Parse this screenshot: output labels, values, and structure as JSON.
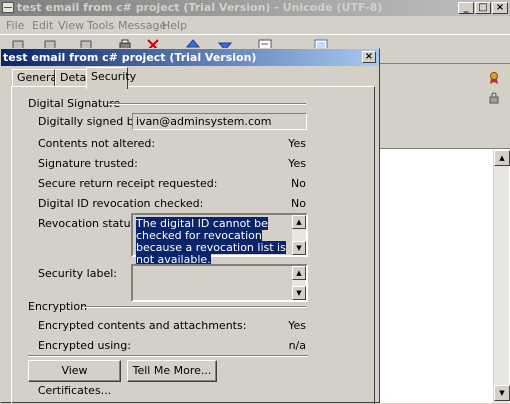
{
  "main_window": {
    "title": "test email from c# project (Trial Version) - Unicode (UTF-8)",
    "title_buttons": [
      "_",
      "□",
      "×"
    ],
    "menu": [
      "File",
      "Edit",
      "View",
      "Tools",
      "Message",
      "Help"
    ],
    "toolbar_fragment": "F"
  },
  "dialog": {
    "title": "test email from c# project (Trial Version)",
    "close_glyph": "×",
    "tabs": [
      "General",
      "Details",
      "Security"
    ],
    "active_tab": "Security",
    "digital_signature": {
      "heading": "Digital Signature",
      "signed_by_label": "Digitally signed by:",
      "signed_by_value": "ivan@adminsystem.com",
      "rows": [
        {
          "label": "Contents not altered:",
          "value": "Yes"
        },
        {
          "label": "Signature trusted:",
          "value": "Yes"
        },
        {
          "label": "Secure return receipt requested:",
          "value": "No"
        },
        {
          "label": "Digital ID revocation checked:",
          "value": "No"
        }
      ],
      "revocation_label": "Revocation status:",
      "revocation_text": "The digital ID cannot be checked  for revocation because a revocation list is not available.",
      "security_label_label": "Security label:",
      "security_label_value": ""
    },
    "encryption": {
      "heading": "Encryption",
      "rows": [
        {
          "label": "Encrypted contents and attachments:",
          "value": "Yes"
        },
        {
          "label": "Encrypted using:",
          "value": "n/a"
        }
      ]
    },
    "buttons": {
      "view_certificates": "View Certificates...",
      "tell_me_more": "Tell Me More..."
    }
  }
}
